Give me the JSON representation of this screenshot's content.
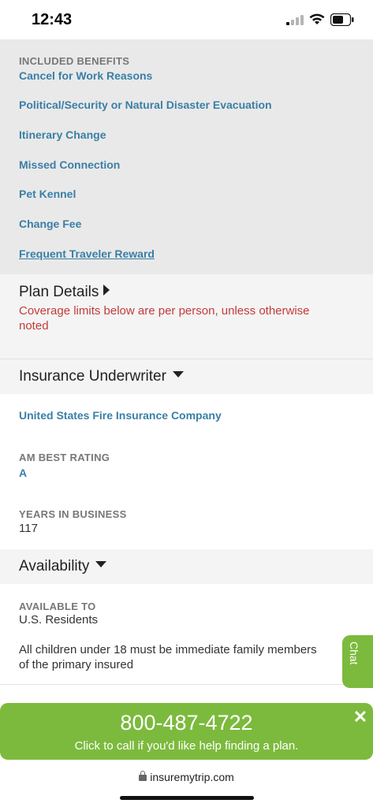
{
  "status_bar": {
    "time": "12:43"
  },
  "included_benefits": {
    "heading": "INCLUDED BENEFITS",
    "items": [
      "Cancel for Work Reasons",
      "Political/Security or Natural Disaster Evacuation",
      "Itinerary Change",
      "Missed Connection",
      "Pet Kennel",
      "Change Fee",
      "Frequent Traveler Reward"
    ]
  },
  "plan_details": {
    "title": "Plan Details",
    "note": "Coverage limits below are per person, unless otherwise noted"
  },
  "insurance_underwriter": {
    "title": "Insurance Underwriter",
    "company": "United States Fire Insurance Company",
    "am_best_label": "AM BEST RATING",
    "am_best_value": "A",
    "years_label": "YEARS IN BUSINESS",
    "years_value": "117"
  },
  "availability": {
    "title": "Availability",
    "available_label": "AVAILABLE TO",
    "available_value": "U.S. Residents",
    "note": "All children under 18 must be immediate family members of the primary insured"
  },
  "chat": {
    "label": "Chat"
  },
  "call_banner": {
    "phone": "800-487-4722",
    "subtitle": "Click to call if you'd like help finding a plan.",
    "close": "✕"
  },
  "browser": {
    "url": "insuremytrip.com"
  },
  "colors": {
    "link": "#3a7fa6",
    "accent_green": "#7cba3d",
    "note_red": "#c23b3b"
  }
}
